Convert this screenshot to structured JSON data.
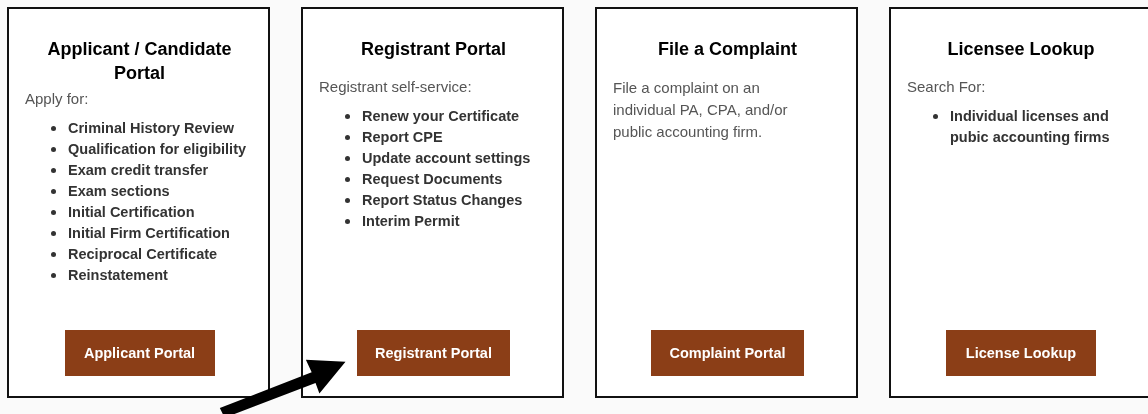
{
  "cards": [
    {
      "kind": "list",
      "title": "Applicant / Candidate Portal",
      "intro": "Apply for:",
      "items": [
        "Criminal History Review",
        "Qualification for eligibility",
        "Exam credit transfer",
        "Exam sections",
        "Initial Certification",
        "Initial Firm Certification",
        "Reciprocal Certificate",
        "Reinstatement"
      ],
      "button": "Applicant Portal"
    },
    {
      "kind": "list",
      "title": "Registrant Portal",
      "intro": "Registrant self-service:",
      "items": [
        "Renew your Certificate",
        "Report CPE",
        "Update account settings",
        "Request Documents",
        "Report Status Changes",
        "Interim Permit"
      ],
      "button": "Registrant Portal"
    },
    {
      "kind": "paragraph",
      "title": "File a Complaint",
      "text": "File a complaint on an individual PA, CPA, and/or public accounting firm.",
      "button": "Complaint Portal"
    },
    {
      "kind": "list",
      "title": "Licensee Lookup",
      "intro": "Search For:",
      "items": [
        "Individual licenses and pubic accounting firms"
      ],
      "button": "License Lookup"
    }
  ]
}
